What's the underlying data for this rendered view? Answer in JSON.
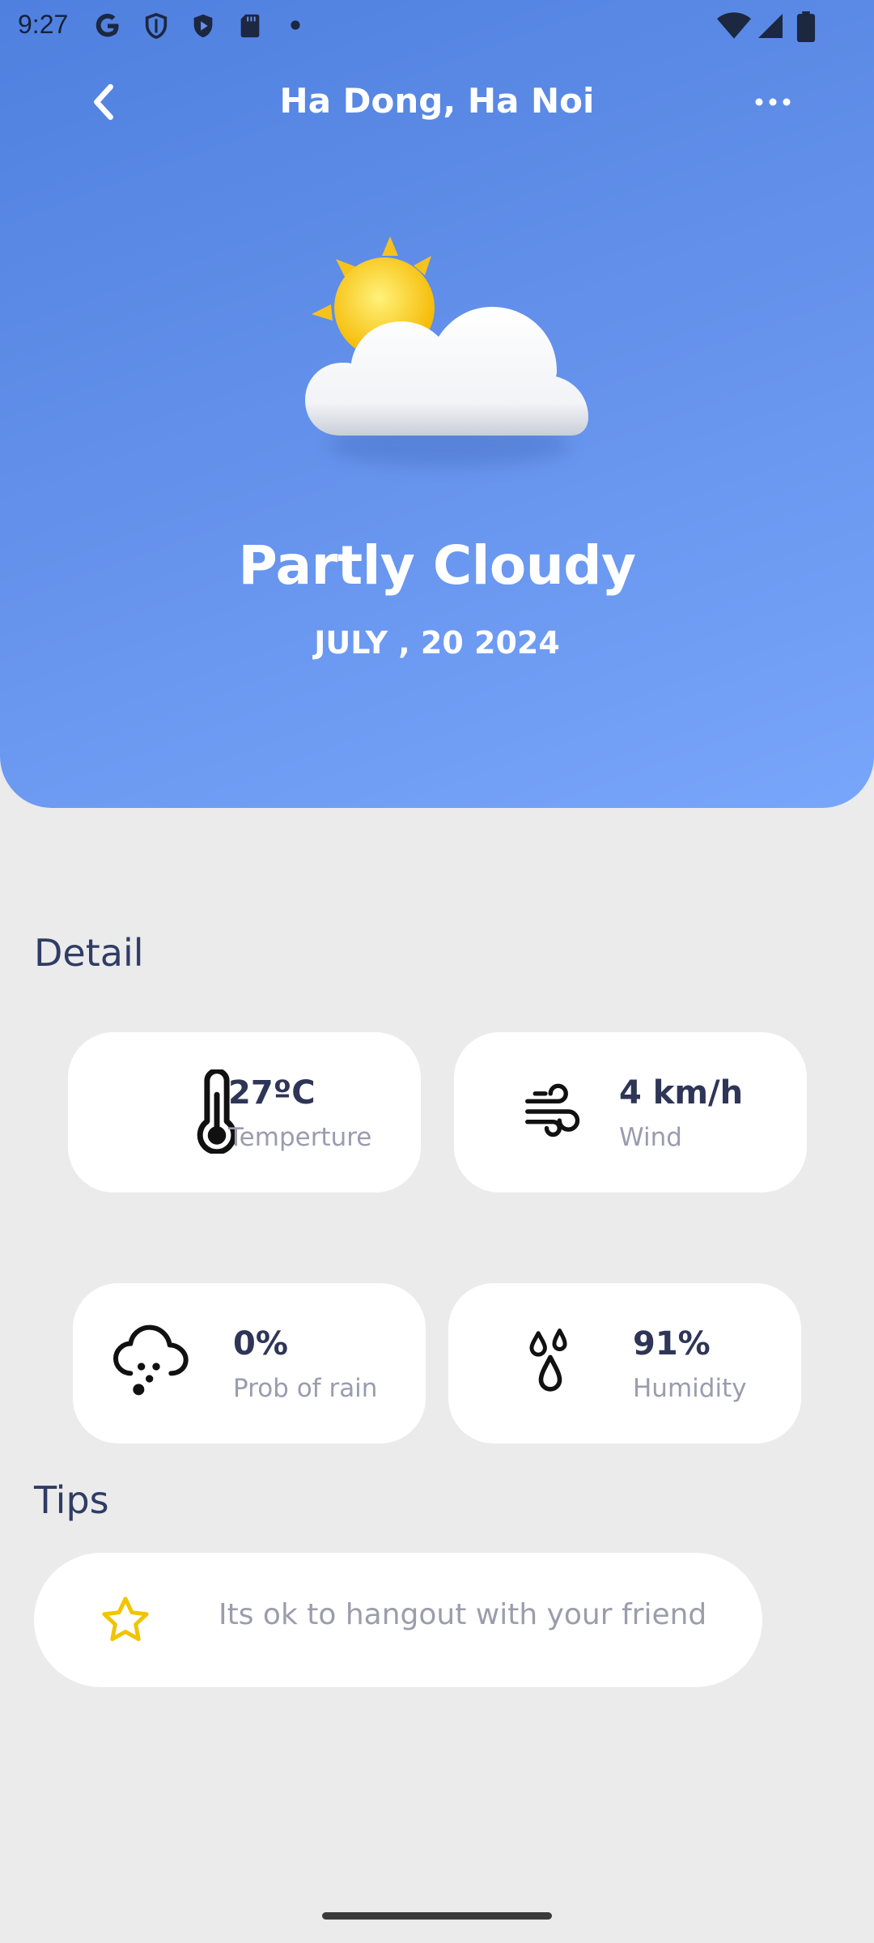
{
  "status_bar": {
    "time": "9:27",
    "left_icons": [
      "google-icon",
      "shield-icon",
      "play-protect-icon",
      "sd-card-icon",
      "dot-icon"
    ],
    "right_icons": [
      "wifi-icon",
      "cellular-icon",
      "battery-icon"
    ]
  },
  "header": {
    "location": "Ha Dong, Ha Noi",
    "back_icon": "chevron-left-icon",
    "more_icon": "more-horizontal-icon"
  },
  "weather": {
    "illustration": "sun-behind-cloud-icon",
    "condition": "Partly Cloudy",
    "date": "JULY , 20 2024"
  },
  "detail": {
    "title": "Detail",
    "items": [
      {
        "icon": "thermometer-icon",
        "value": "27ºC",
        "label": "Temperture"
      },
      {
        "icon": "wind-icon",
        "value": "4 km/h",
        "label": "Wind"
      },
      {
        "icon": "cloud-rain-icon",
        "value": "0%",
        "label": "Prob of rain"
      },
      {
        "icon": "humidity-drops-icon",
        "value": "91%",
        "label": "Humidity"
      }
    ]
  },
  "tips": {
    "title": "Tips",
    "icon": "star-icon",
    "text": "Its ok to hangout with your friend"
  },
  "colors": {
    "hero_gradient_start": "#4f80df",
    "hero_gradient_end": "#78a6fb",
    "background": "#ebebeb",
    "card_background": "#ffffff",
    "text_primary": "#2f3557",
    "text_secondary": "#9a9cae",
    "section_title": "#2f3c66",
    "star_accent": "#f2c400"
  }
}
